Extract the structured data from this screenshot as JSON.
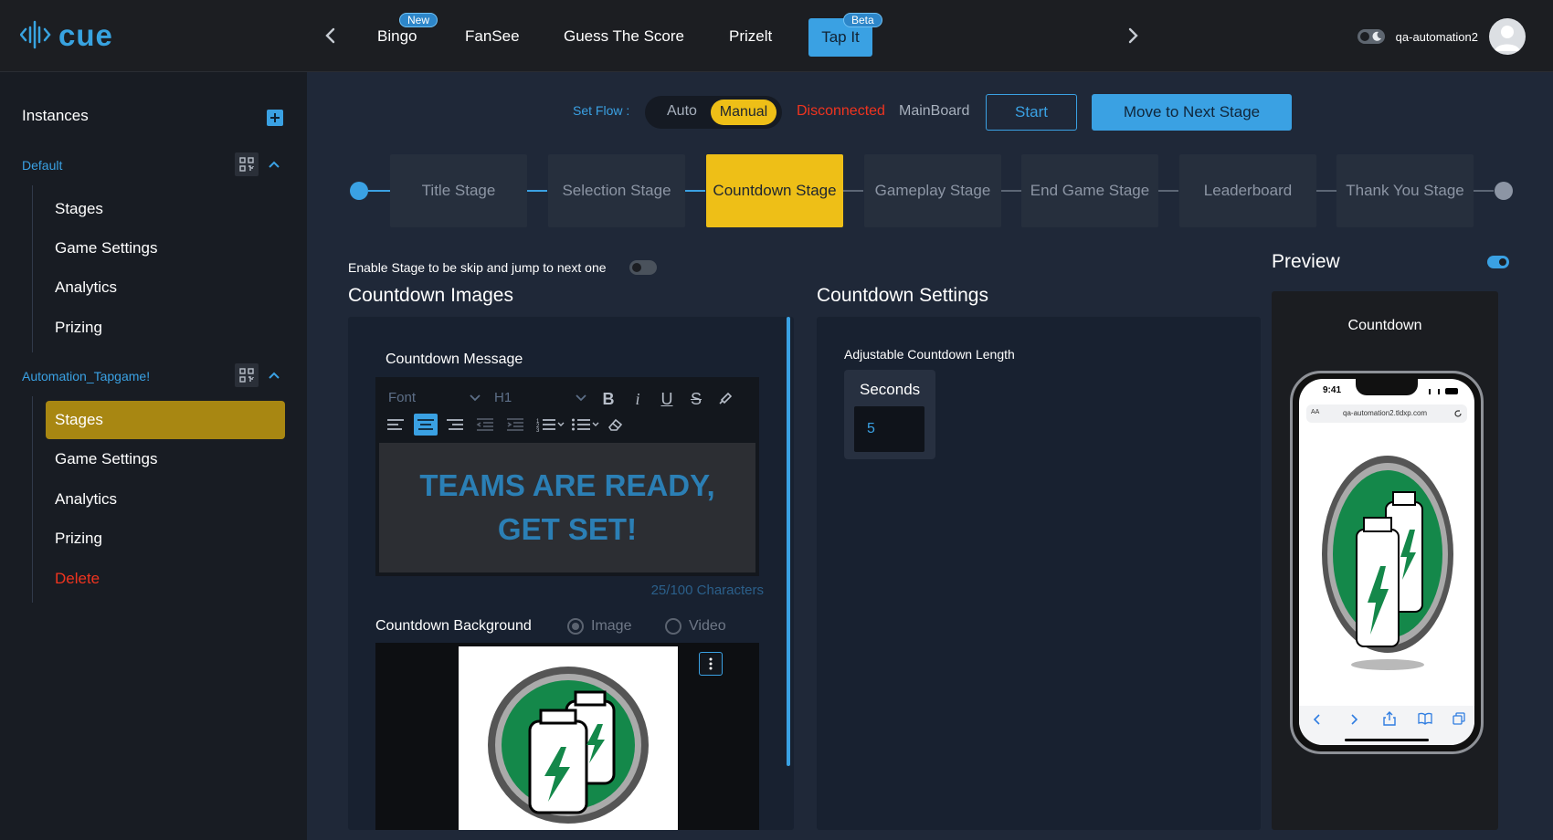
{
  "brand": {
    "name": "cue",
    "color": "#38a3e0"
  },
  "nav": {
    "items": [
      {
        "label": "Bingo",
        "badge": "New"
      },
      {
        "label": "FanSee",
        "badge": ""
      },
      {
        "label": "Guess The Score",
        "badge": ""
      },
      {
        "label": "Prizelt",
        "badge": ""
      },
      {
        "label": "Tap It",
        "badge": "Beta",
        "active": true
      }
    ]
  },
  "user": {
    "name": "qa-automation2"
  },
  "sidebar": {
    "title": "Instances",
    "instances": [
      {
        "name": "Default",
        "items": [
          "Stages",
          "Game Settings",
          "Analytics",
          "Prizing"
        ]
      },
      {
        "name": "Automation_Tapgame!",
        "items": [
          "Stages",
          "Game Settings",
          "Analytics",
          "Prizing",
          "Delete"
        ],
        "active_item": "Stages"
      }
    ]
  },
  "flow": {
    "set_flow_label": "Set Flow :",
    "mode_auto": "Auto",
    "mode_manual": "Manual",
    "selected_mode": "Manual",
    "status": "Disconnected",
    "board": "MainBoard",
    "start_button": "Start",
    "next_button": "Move to Next Stage"
  },
  "stages": [
    "Title Stage",
    "Selection Stage",
    "Countdown Stage",
    "Gameplay Stage",
    "End Game Stage",
    "Leaderboard",
    "Thank You Stage"
  ],
  "active_stage": "Countdown Stage",
  "skip": {
    "label": "Enable Stage to be skip and jump to next one",
    "enabled": false
  },
  "images": {
    "title": "Countdown Images",
    "message_label": "Countdown Message",
    "font_placeholder": "Font",
    "heading_select": "H1",
    "message_line1": "TEAMS ARE READY,",
    "message_line2": "GET SET!",
    "char_count": "25/100 Characters",
    "background_label": "Countdown Background",
    "bg_option_image": "Image",
    "bg_option_video": "Video"
  },
  "settings": {
    "title": "Countdown Settings",
    "length_label": "Adjustable Countdown Length",
    "seconds_label": "Seconds",
    "seconds_value": "5"
  },
  "preview": {
    "title": "Preview",
    "enabled": true,
    "screen_title": "Countdown",
    "phone_time": "9:41",
    "phone_url": "qa-automation2.tldxp.com",
    "phone_aa": "AA"
  },
  "colors": {
    "accent": "#3aa1e3",
    "active_stage": "#eebf17",
    "active_sidebar": "#a88712",
    "danger": "#f0341f",
    "message_text": "#2b7fb5"
  }
}
